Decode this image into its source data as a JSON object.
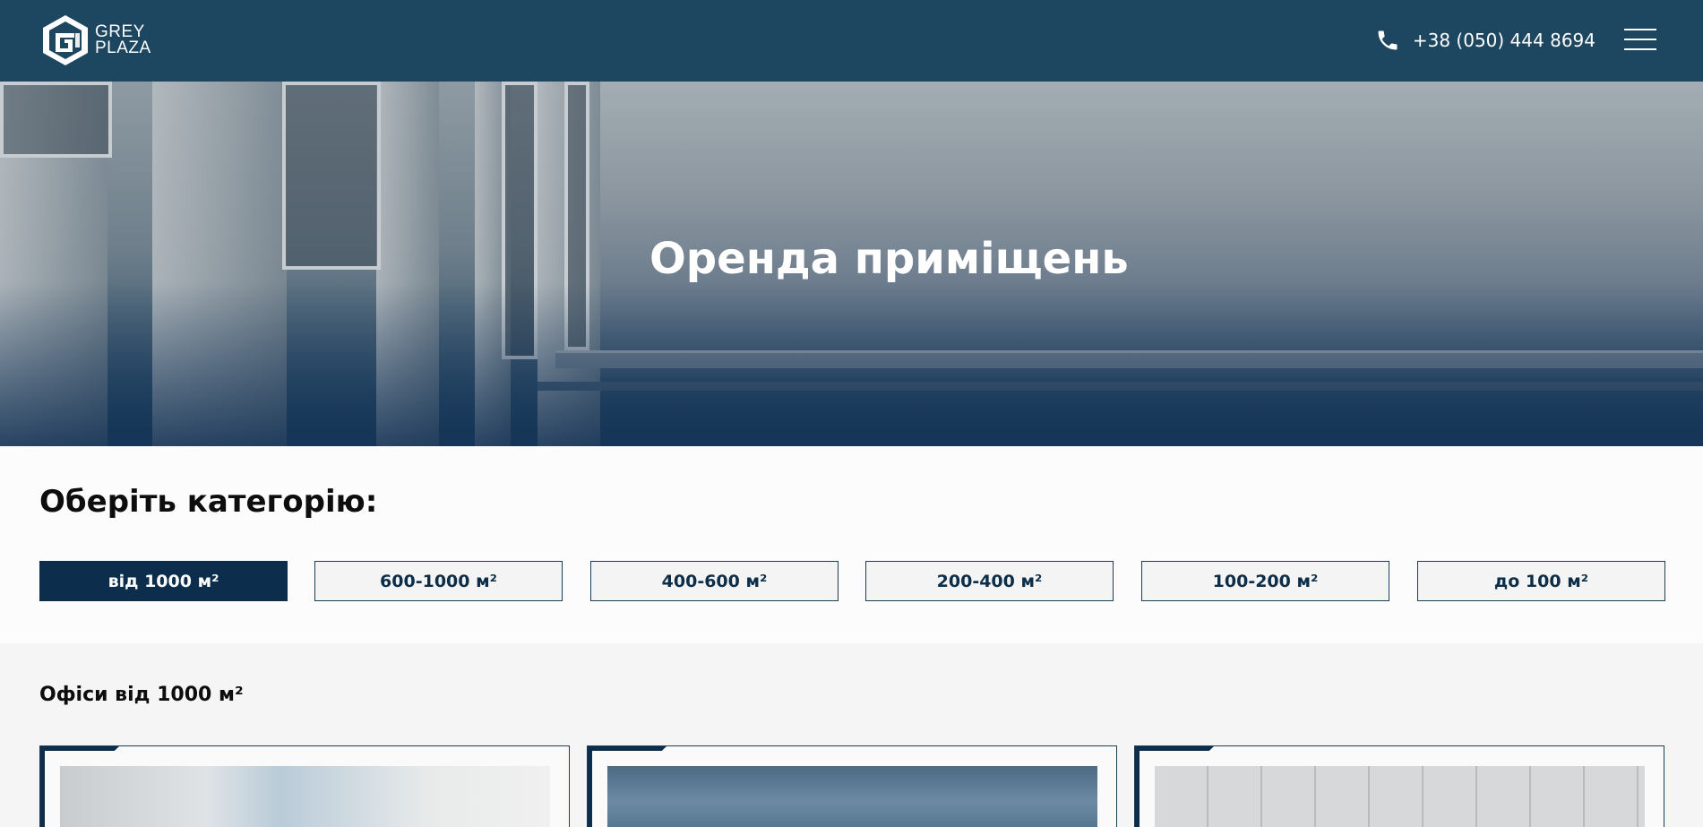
{
  "header": {
    "logo_line1": "GREY",
    "logo_line2": "PLAZA",
    "phone": "+38 (050) 444 8694"
  },
  "hero": {
    "title": "Оренда приміщень"
  },
  "categories": {
    "title": "Оберіть категорію:",
    "items": [
      {
        "label": "від 1000 м²",
        "active": true
      },
      {
        "label": "600-1000 м²",
        "active": false
      },
      {
        "label": "400-600 м²",
        "active": false
      },
      {
        "label": "200-400 м²",
        "active": false
      },
      {
        "label": "100-200 м²",
        "active": false
      },
      {
        "label": "до 100 м²",
        "active": false
      }
    ]
  },
  "offices": {
    "title": "Офіси від 1000 м²",
    "cards_count_visible": 3
  },
  "colors": {
    "header_bg": "#1d4660",
    "accent_dark": "#0c2e4c",
    "section_bg": "#f5f5f5",
    "white": "#ffffff"
  },
  "icons": [
    "logo-icon",
    "phone-icon",
    "hamburger-menu-icon"
  ]
}
